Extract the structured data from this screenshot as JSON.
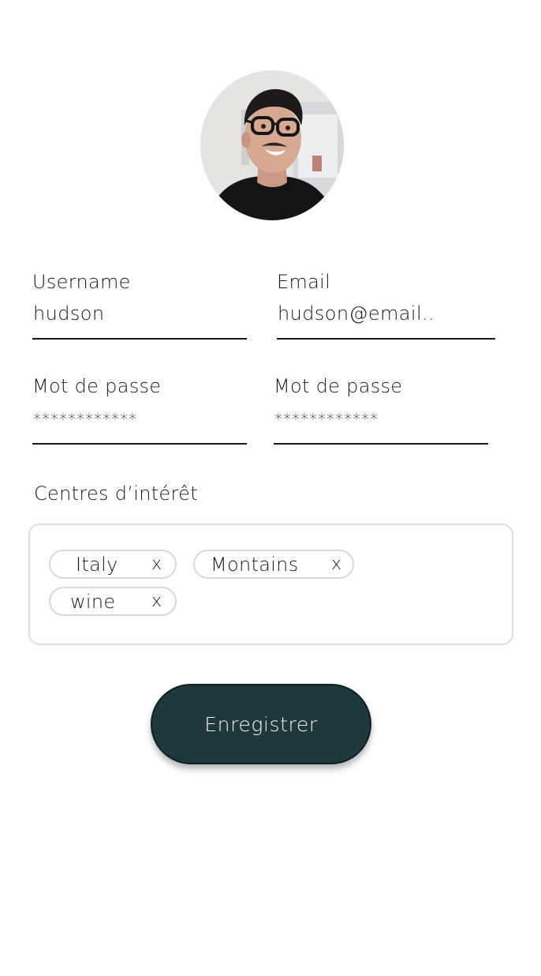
{
  "profile": {
    "avatar_icon": "user-photo"
  },
  "form": {
    "username": {
      "label": "Username",
      "value": "hudson"
    },
    "email": {
      "label": "Email",
      "value": "hudson@email.."
    },
    "password": {
      "label": "Mot de passe",
      "value": "************"
    },
    "password_confirm": {
      "label": "Mot de passe",
      "value": "************"
    }
  },
  "interests": {
    "label": "Centres d’intérêt",
    "tags": [
      {
        "label": "Italy",
        "remove": "x"
      },
      {
        "label": "Montains",
        "remove": "x"
      },
      {
        "label": "wine",
        "remove": "x"
      }
    ]
  },
  "actions": {
    "save_label": "Enregistrer"
  },
  "colors": {
    "button_bg": "#1e383c",
    "button_text": "#f2f2f2",
    "underline": "#1a1a1a",
    "chip_border": "#d9d9d9",
    "box_border": "#dedede"
  }
}
